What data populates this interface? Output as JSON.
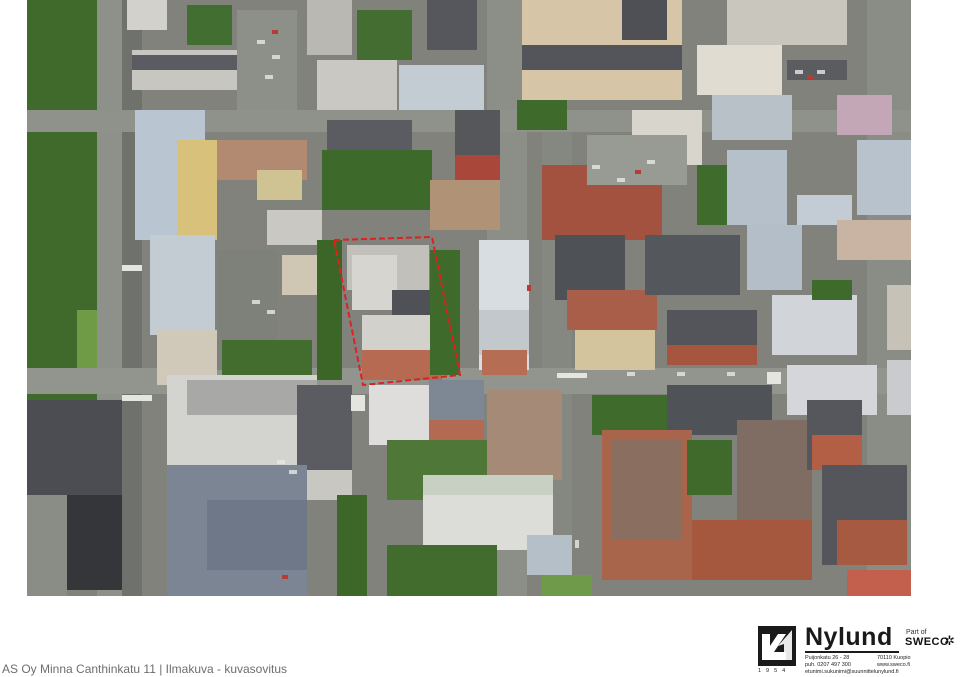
{
  "caption": "AS Oy Minna Canthinkatu 11  |  Ilmakuva - kuvasovitus",
  "logo": {
    "brand": "Nylund",
    "year": "1954",
    "part_of": "Part of",
    "parent": "SWECO",
    "address_line": "Puijonkatu 26 - 28",
    "city": "70110 Kuopio",
    "phone": "puh. 0207 497 300",
    "web": "www.sweco.fi",
    "email": "etunimi.sukunimi@suunnittelunylund.fi"
  },
  "colors": {
    "highlight_outline": "#e0201e",
    "roof_light": "#c9c9c6",
    "roof_dark": "#4d4f55",
    "roof_brick": "#9a5a44",
    "vegetation": "#3e6b2c",
    "asphalt": "#7d7f78"
  },
  "icons": {
    "logo_mark": "nylund-mark-icon",
    "sweco_mark": "sweco-star-icon"
  }
}
